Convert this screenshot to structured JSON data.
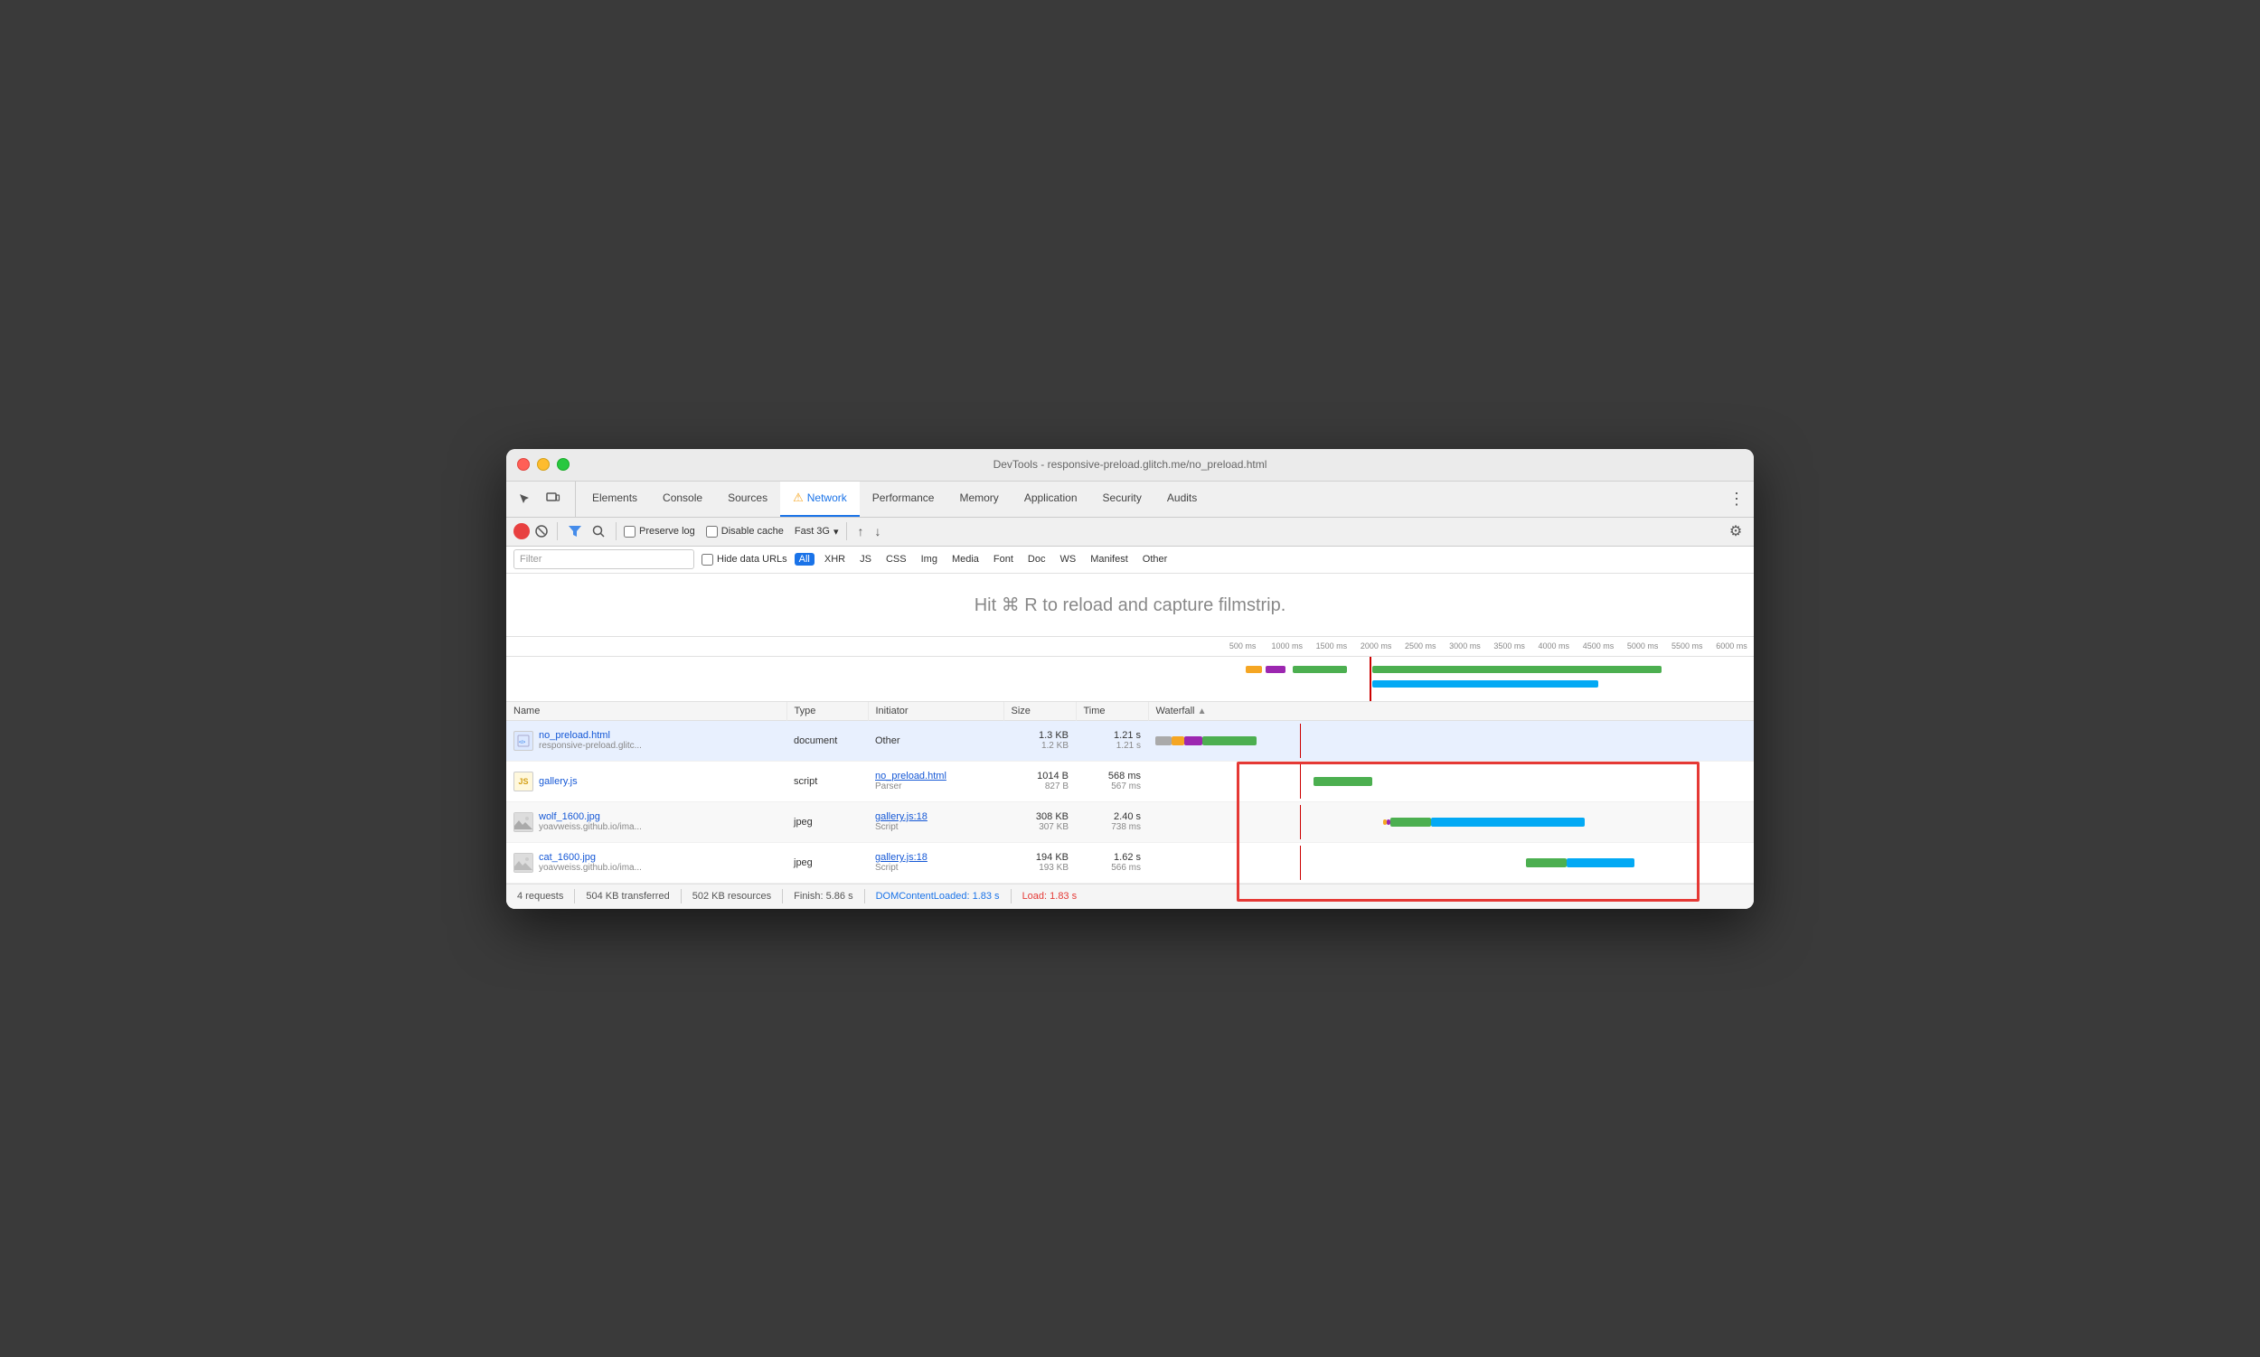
{
  "window": {
    "title": "DevTools - responsive-preload.glitch.me/no_preload.html",
    "traffic_lights": [
      "close",
      "minimize",
      "maximize"
    ]
  },
  "tabs": {
    "items": [
      {
        "label": "Elements",
        "active": false
      },
      {
        "label": "Console",
        "active": false
      },
      {
        "label": "Sources",
        "active": false
      },
      {
        "label": "Network",
        "active": true,
        "warning": true
      },
      {
        "label": "Performance",
        "active": false
      },
      {
        "label": "Memory",
        "active": false
      },
      {
        "label": "Application",
        "active": false
      },
      {
        "label": "Security",
        "active": false
      },
      {
        "label": "Audits",
        "active": false
      }
    ],
    "more_label": "⋮"
  },
  "toolbar": {
    "record_title": "Record",
    "stop_title": "Stop recording",
    "filter_title": "Filter",
    "search_title": "Search",
    "preserve_log_label": "Preserve log",
    "disable_cache_label": "Disable cache",
    "throttle_label": "Fast 3G",
    "upload_label": "↑",
    "download_label": "↓",
    "settings_label": "⚙"
  },
  "filter_bar": {
    "placeholder": "Filter",
    "hide_data_urls_label": "Hide data URLs",
    "types": [
      {
        "label": "All",
        "active": true
      },
      {
        "label": "XHR",
        "active": false
      },
      {
        "label": "JS",
        "active": false
      },
      {
        "label": "CSS",
        "active": false
      },
      {
        "label": "Img",
        "active": false
      },
      {
        "label": "Media",
        "active": false
      },
      {
        "label": "Font",
        "active": false
      },
      {
        "label": "Doc",
        "active": false
      },
      {
        "label": "WS",
        "active": false
      },
      {
        "label": "Manifest",
        "active": false
      },
      {
        "label": "Other",
        "active": false
      }
    ]
  },
  "filmstrip": {
    "hint": "Hit ⌘ R to reload and capture filmstrip."
  },
  "timeline": {
    "ticks": [
      "500 ms",
      "1000 ms",
      "1500 ms",
      "2000 ms",
      "2500 ms",
      "3000 ms",
      "3500 ms",
      "4000 ms",
      "4500 ms",
      "5000 ms",
      "5500 ms",
      "6000 ms"
    ]
  },
  "table": {
    "columns": [
      "Name",
      "Type",
      "Initiator",
      "Size",
      "Time",
      "Waterfall"
    ],
    "rows": [
      {
        "id": 1,
        "name": "no_preload.html",
        "name_sub": "responsive-preload.glitc...",
        "icon_type": "html",
        "type": "document",
        "initiator": "Other",
        "initiator_link": false,
        "initiator_sub": "",
        "size": "1.3 KB",
        "size_sub": "1.2 KB",
        "time": "1.21 s",
        "time_sub": "1.21 s",
        "selected": true
      },
      {
        "id": 2,
        "name": "gallery.js",
        "name_sub": "",
        "icon_type": "js",
        "type": "script",
        "initiator": "no_preload.html",
        "initiator_link": true,
        "initiator_sub": "Parser",
        "size": "1014 B",
        "size_sub": "827 B",
        "time": "568 ms",
        "time_sub": "567 ms",
        "selected": false
      },
      {
        "id": 3,
        "name": "wolf_1600.jpg",
        "name_sub": "yoavweiss.github.io/ima...",
        "icon_type": "img",
        "type": "jpeg",
        "initiator": "gallery.js:18",
        "initiator_link": true,
        "initiator_sub": "Script",
        "size": "308 KB",
        "size_sub": "307 KB",
        "time": "2.40 s",
        "time_sub": "738 ms",
        "selected": false
      },
      {
        "id": 4,
        "name": "cat_1600.jpg",
        "name_sub": "yoavweiss.github.io/ima...",
        "icon_type": "img",
        "type": "jpeg",
        "initiator": "gallery.js:18",
        "initiator_link": true,
        "initiator_sub": "Script",
        "size": "194 KB",
        "size_sub": "193 KB",
        "time": "1.62 s",
        "time_sub": "566 ms",
        "selected": false
      }
    ]
  },
  "status_bar": {
    "requests": "4 requests",
    "transferred": "504 KB transferred",
    "resources": "502 KB resources",
    "finish": "Finish: 5.86 s",
    "dom_content_loaded": "DOMContentLoaded: 1.83 s",
    "load": "Load: 1.83 s"
  }
}
